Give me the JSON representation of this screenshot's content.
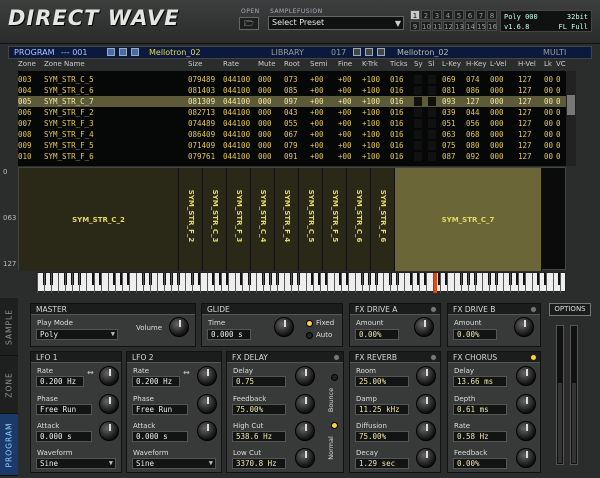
{
  "app": {
    "logo": "DIRECT WAVE"
  },
  "topbar": {
    "open_label": "OPEN",
    "samplefusion_label": "SAMPLEFUSION",
    "preset_value": "Select Preset",
    "multi_slots": [
      "1",
      "2",
      "3",
      "4",
      "5",
      "6",
      "7",
      "8",
      "9",
      "10",
      "11",
      "12",
      "13",
      "14",
      "15",
      "16"
    ],
    "status": {
      "poly": "Poly 000",
      "bits": "32bit",
      "version": "v1.6.8",
      "mode": "FL Full"
    }
  },
  "program_bar": {
    "program_label": "PROGRAM",
    "program_num": "--- 001",
    "program_name": "Mellotron_02",
    "library_label": "LIBRARY",
    "library_num": "017",
    "library_name": "Mellotron_02",
    "multi_label": "MULTI"
  },
  "zone_table": {
    "headers": [
      "Zone",
      "Zone Name",
      "Size",
      "Rate",
      "Mute",
      "Root",
      "Semi",
      "Fine",
      "K-Trk",
      "Ticks",
      "Sy",
      "Sl",
      "L-Key",
      "H-Key",
      "L-Vel",
      "H-Vel",
      "Lk",
      "VC"
    ],
    "rows": [
      [
        "003",
        "SYM_STR_C_5",
        "079489",
        "044100",
        "000",
        "073",
        "+00",
        "+00",
        "+100",
        "016",
        "",
        "",
        "069",
        "074",
        "000",
        "127",
        "00",
        "0"
      ],
      [
        "004",
        "SYM_STR_C_6",
        "081403",
        "044100",
        "000",
        "085",
        "+00",
        "+00",
        "+100",
        "016",
        "",
        "",
        "081",
        "086",
        "000",
        "127",
        "00",
        "0"
      ],
      [
        "005",
        "SYM_STR_C_7",
        "081309",
        "044100",
        "000",
        "097",
        "+00",
        "+00",
        "+100",
        "016",
        "",
        "",
        "093",
        "127",
        "000",
        "127",
        "00",
        "0"
      ],
      [
        "006",
        "SYM_STR_F_2",
        "082713",
        "044100",
        "000",
        "043",
        "+00",
        "+00",
        "+100",
        "016",
        "",
        "",
        "039",
        "044",
        "000",
        "127",
        "00",
        "0"
      ],
      [
        "007",
        "SYM_STR_F_3",
        "074489",
        "044100",
        "000",
        "055",
        "+00",
        "+00",
        "+100",
        "016",
        "",
        "",
        "051",
        "056",
        "000",
        "127",
        "00",
        "0"
      ],
      [
        "008",
        "SYM_STR_F_4",
        "086409",
        "044100",
        "000",
        "067",
        "+00",
        "+00",
        "+100",
        "016",
        "",
        "",
        "063",
        "068",
        "000",
        "127",
        "00",
        "0"
      ],
      [
        "009",
        "SYM_STR_F_5",
        "071409",
        "044100",
        "000",
        "079",
        "+00",
        "+00",
        "+100",
        "016",
        "",
        "",
        "075",
        "080",
        "000",
        "127",
        "00",
        "0"
      ],
      [
        "010",
        "SYM_STR_F_6",
        "079761",
        "044100",
        "000",
        "091",
        "+00",
        "+00",
        "+100",
        "016",
        "",
        "",
        "087",
        "092",
        "000",
        "127",
        "00",
        "0"
      ]
    ],
    "selected_row": 2
  },
  "zone_map": {
    "vel_labels": [
      "0",
      "063",
      "127"
    ],
    "zones": [
      "SYM_STR_C_2",
      "SYM_STR_F_2",
      "SYM_STR_C_3",
      "SYM_STR_F_3",
      "SYM_STR_C_4",
      "SYM_STR_F_4",
      "SYM_STR_C_5",
      "SYM_STR_F_5",
      "SYM_STR_C_6",
      "SYM_STR_F_6",
      "SYM_STR_C_7"
    ]
  },
  "side_tabs": [
    "SAMPLE",
    "ZONE",
    "PROGRAM"
  ],
  "master": {
    "title": "MASTER",
    "play_mode_label": "Play Mode",
    "play_mode_value": "Poly",
    "volume_label": "Volume"
  },
  "glide": {
    "title": "GLIDE",
    "time_label": "Time",
    "time_value": "0.000 s",
    "fixed_label": "Fixed",
    "auto_label": "Auto"
  },
  "fx_drive_a": {
    "title": "FX DRIVE A",
    "amount_label": "Amount",
    "amount_value": "0.00%"
  },
  "fx_drive_b": {
    "title": "FX DRIVE B",
    "amount_label": "Amount",
    "amount_value": "0.00%"
  },
  "options_label": "OPTIONS",
  "lfo1": {
    "title": "LFO 1",
    "rate_label": "Rate",
    "rate_value": "0.200 Hz",
    "phase_label": "Phase",
    "phase_value": "Free Run",
    "attack_label": "Attack",
    "attack_value": "0.000 s",
    "waveform_label": "Waveform",
    "waveform_value": "Sine"
  },
  "lfo2": {
    "title": "LFO 2",
    "rate_label": "Rate",
    "rate_value": "0.200 Hz",
    "phase_label": "Phase",
    "phase_value": "Free Run",
    "attack_label": "Attack",
    "attack_value": "0.000 s",
    "waveform_label": "Waveform",
    "waveform_value": "Sine"
  },
  "fx_delay": {
    "title": "FX DELAY",
    "delay_label": "Delay",
    "delay_value": "0.75",
    "feedback_label": "Feedback",
    "feedback_value": "75.00%",
    "highcut_label": "High Cut",
    "highcut_value": "538.6 Hz",
    "lowcut_label": "Low Cut",
    "lowcut_value": "3370.8 Hz",
    "bounce_label": "Bounce",
    "normal_label": "Normal"
  },
  "fx_reverb": {
    "title": "FX REVERB",
    "room_label": "Room",
    "room_value": "25.00%",
    "damp_label": "Damp",
    "damp_value": "11.25 kHz",
    "diffusion_label": "Diffusion",
    "diffusion_value": "75.00%",
    "decay_label": "Decay",
    "decay_value": "1.29 sec"
  },
  "fx_chorus": {
    "title": "FX CHORUS",
    "delay_label": "Delay",
    "delay_value": "13.66 ms",
    "depth_label": "Depth",
    "depth_value": "0.61 ms",
    "rate_label": "Rate",
    "rate_value": "0.58 Hz",
    "feedback_label": "Feedback",
    "feedback_value": "0.00%"
  },
  "colors": {
    "accent_yellow": "#e8c84a",
    "selected_row": "#5d5a3a",
    "led_on": "#ffd23a",
    "program_tab": "#1b3a6a"
  }
}
